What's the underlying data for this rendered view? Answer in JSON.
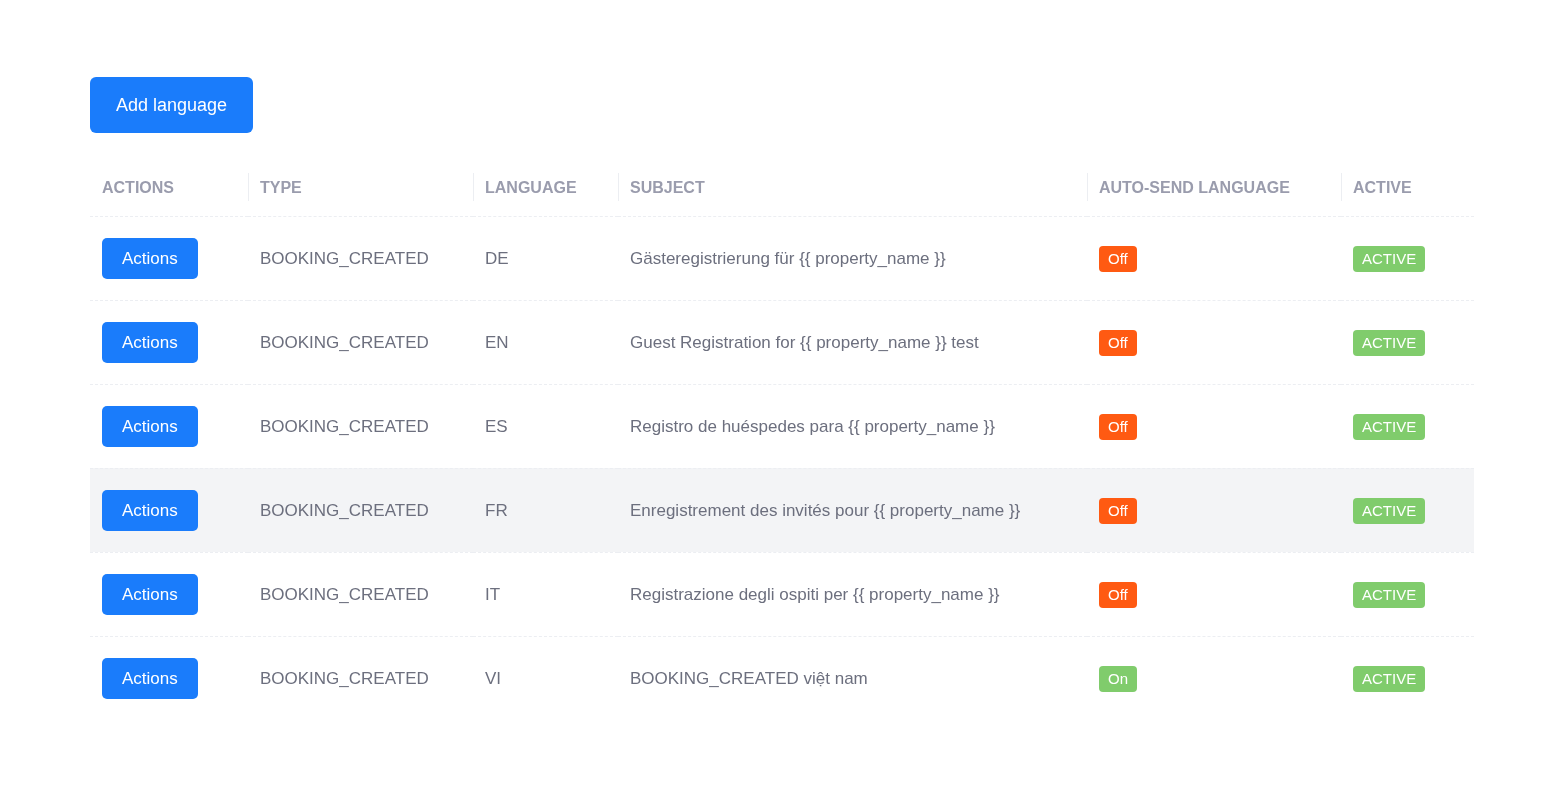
{
  "add_button": "Add language",
  "table": {
    "columns": [
      "ACTIONS",
      "TYPE",
      "LANGUAGE",
      "SUBJECT",
      "AUTO-SEND LANGUAGE",
      "ACTIVE"
    ],
    "rows": [
      {
        "action": "Actions",
        "type": "BOOKING_CREATED",
        "language": "DE",
        "subject": "Gästeregistrierung für {{ property_name }}",
        "auto_send": {
          "label": "Off",
          "on": false
        },
        "status": {
          "label": "ACTIVE",
          "active": true
        },
        "highlighted": false
      },
      {
        "action": "Actions",
        "type": "BOOKING_CREATED",
        "language": "EN",
        "subject": "Guest Registration for {{ property_name }} test",
        "auto_send": {
          "label": "Off",
          "on": false
        },
        "status": {
          "label": "ACTIVE",
          "active": true
        },
        "highlighted": false
      },
      {
        "action": "Actions",
        "type": "BOOKING_CREATED",
        "language": "ES",
        "subject": "Registro de huéspedes para {{ property_name }}",
        "auto_send": {
          "label": "Off",
          "on": false
        },
        "status": {
          "label": "ACTIVE",
          "active": true
        },
        "highlighted": false
      },
      {
        "action": "Actions",
        "type": "BOOKING_CREATED",
        "language": "FR",
        "subject": "Enregistrement des invités pour {{ property_name }}",
        "auto_send": {
          "label": "Off",
          "on": false
        },
        "status": {
          "label": "ACTIVE",
          "active": true
        },
        "highlighted": true
      },
      {
        "action": "Actions",
        "type": "BOOKING_CREATED",
        "language": "IT",
        "subject": "Registrazione degli ospiti per {{ property_name }}",
        "auto_send": {
          "label": "Off",
          "on": false
        },
        "status": {
          "label": "ACTIVE",
          "active": true
        },
        "highlighted": false
      },
      {
        "action": "Actions",
        "type": "BOOKING_CREATED",
        "language": "VI",
        "subject": "BOOKING_CREATED việt nam",
        "auto_send": {
          "label": "On",
          "on": true
        },
        "status": {
          "label": "ACTIVE",
          "active": true
        },
        "highlighted": false
      }
    ]
  }
}
